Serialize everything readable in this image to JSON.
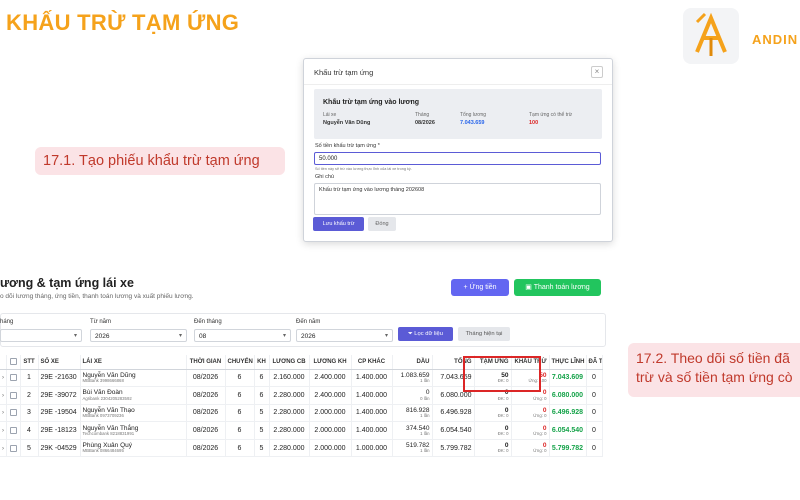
{
  "slide": {
    "title": "KHẤU TRỪ TẠM ỨNG",
    "brand": "ANDIN"
  },
  "callouts": [
    {
      "lines": [
        "17.1. Tạo phiếu khẩu trừ tạm ứng"
      ]
    },
    {
      "lines": [
        "17.2. Theo dõi số tiền đã",
        "trừ và số tiền tạm ứng cò"
      ]
    }
  ],
  "modal": {
    "title": "Khấu trừ tạm ứng",
    "close_glyph": "×",
    "summary_title": "Khấu trừ tạm ứng vào lương",
    "summary_cols": [
      {
        "label": "Lái xe",
        "value": "Nguyễn Văn Dũng"
      },
      {
        "label": "Tháng",
        "value": "08/2026"
      },
      {
        "label": "Tổng lương",
        "value": "7.043.659"
      },
      {
        "label": "Tạm ứng có thể trừ",
        "value": "100"
      }
    ],
    "amount_label": "Số tiền khấu trừ tạm ứng *",
    "amount_value": "50.000",
    "amount_hint": "Số tiền này sẽ trừ vào lương thực lĩnh của lái xe trong kỳ.",
    "note_label": "Ghi chú",
    "note_value": "Khấu trừ tạm ứng vào lương tháng 202608",
    "save_label": "Lưu khấu trừ",
    "close_label": "Đóng",
    "colors": {
      "primary": "#5b5bd6",
      "total_salary": "#2563eb",
      "deductible": "#dc2626"
    }
  },
  "page": {
    "title": "ương & tạm ứng lái xe",
    "subtitle": "o dõi lương tháng, ứng tiền, thanh toán lương và xuất phiếu lương.",
    "btn_advance": "+ Ứng tiền",
    "btn_pay": "Thanh toán lương",
    "filters": {
      "labels": [
        "háng",
        "Từ năm",
        "Đến tháng",
        "Đến năm"
      ],
      "values": [
        "",
        "2026",
        "08",
        "2026"
      ],
      "filter_btn": "Lọc dữ liệu",
      "current_btn": "Tháng hiện tại"
    }
  },
  "table": {
    "headers": [
      "STT",
      "SỐ XE",
      "LÁI XE",
      "THỜI GIAN",
      "CHUYẾN",
      "KH",
      "LƯƠNG CB",
      "LƯƠNG KH",
      "CP KHÁC",
      "DẦU",
      "TỔNG",
      "TẠM ỨNG",
      "KHẤU TRỪ",
      "THỰC LĨNH",
      "ĐÃ TT"
    ],
    "rows": [
      {
        "stt": "1",
        "plate": "29E -21630",
        "name": "Nguyễn Văn Dũng",
        "bank": "MBBank 3998666868",
        "time": "08/2026",
        "trips": "6",
        "kh": "6",
        "base": "2.160.000",
        "khpay": "2.400.000",
        "other": "1.400.000",
        "fuel": "1.083.659",
        "fuel_count": "1 lần",
        "total": "7.043.659",
        "adv": "50",
        "adv_sub": "ĐK: 0",
        "ded": "50",
        "ded_sub": "Ứng: 100",
        "net": "7.043.609",
        "paid": "0"
      },
      {
        "stt": "2",
        "plate": "29E -39072",
        "name": "Bùi Văn Đoàn",
        "bank": "Agribank 2304205283592",
        "time": "08/2026",
        "trips": "6",
        "kh": "6",
        "base": "2.280.000",
        "khpay": "2.400.000",
        "other": "1.400.000",
        "fuel": "0",
        "fuel_count": "0 lần",
        "total": "6.080.000",
        "adv": "0",
        "adv_sub": "ĐK: 0",
        "ded": "0",
        "ded_sub": "Ứng: 0",
        "net": "6.080.000",
        "paid": "0"
      },
      {
        "stt": "3",
        "plate": "29E -19504",
        "name": "Nguyễn Văn Thạo",
        "bank": "MBBank 0973709236",
        "time": "08/2026",
        "trips": "6",
        "kh": "5",
        "base": "2.280.000",
        "khpay": "2.000.000",
        "other": "1.400.000",
        "fuel": "816.928",
        "fuel_count": "1 lần",
        "total": "6.496.928",
        "adv": "0",
        "adv_sub": "ĐK: 0",
        "ded": "0",
        "ded_sub": "Ứng: 0",
        "net": "6.496.928",
        "paid": "0"
      },
      {
        "stt": "4",
        "plate": "29E -18123",
        "name": "Nguyễn Văn Thắng",
        "bank": "Techcombank 8218831991",
        "time": "08/2026",
        "trips": "6",
        "kh": "5",
        "base": "2.280.000",
        "khpay": "2.000.000",
        "other": "1.400.000",
        "fuel": "374.540",
        "fuel_count": "1 lần",
        "total": "6.054.540",
        "adv": "0",
        "adv_sub": "ĐK: 0",
        "ded": "0",
        "ded_sub": "Ứng: 0",
        "net": "6.054.540",
        "paid": "0"
      },
      {
        "stt": "5",
        "plate": "29K -04529",
        "name": "Phùng Xuân Quý",
        "bank": "MBBank 0866484695",
        "time": "08/2026",
        "trips": "6",
        "kh": "5",
        "base": "2.280.000",
        "khpay": "2.000.000",
        "other": "1.000.000",
        "fuel": "519.782",
        "fuel_count": "1 lần",
        "total": "5.799.782",
        "adv": "0",
        "adv_sub": "ĐK: 0",
        "ded": "0",
        "ded_sub": "Ứng: 0",
        "net": "5.799.782",
        "paid": "0"
      }
    ]
  },
  "colors": {
    "title_orange": "#f5a21b",
    "callout_bg": "#fbe3e6",
    "callout_text": "#c0392b",
    "net_green": "#16a34a",
    "highlight_red": "#dc2626"
  }
}
